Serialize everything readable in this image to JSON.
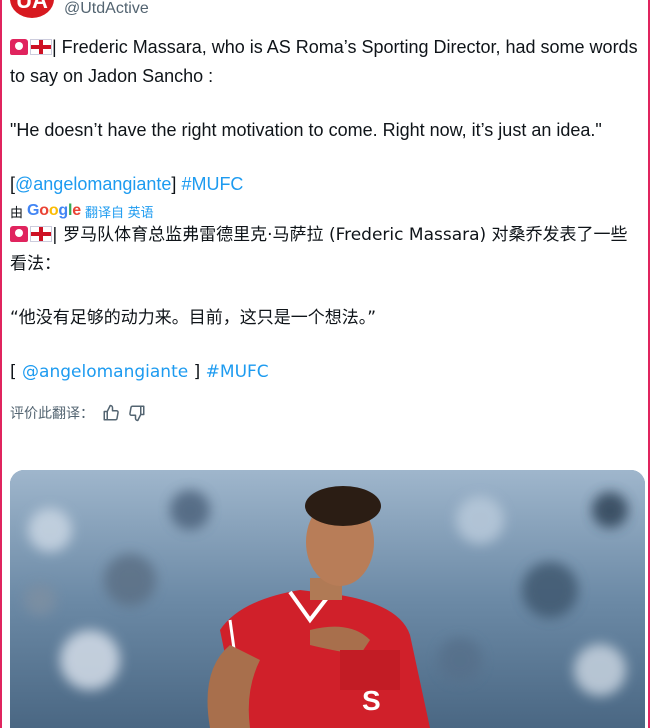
{
  "account": {
    "avatar_text": "UA",
    "handle": "@UtdActive"
  },
  "original": {
    "line1": "| Frederic Massara, who is AS Roma’s Sporting Director, had some words to say on Jadon Sancho :",
    "quote": "\"He doesn’t have the right motivation to come. Right now, it’s just an idea.\"",
    "bracket_open": "[",
    "mention": "@angelomangiante",
    "bracket_close": "]",
    "hashtag": "#MUFC"
  },
  "translation_bar": {
    "prefix": "由",
    "google_letters": [
      "G",
      "o",
      "o",
      "g",
      "l",
      "e"
    ],
    "link": "翻译自 英语"
  },
  "translated": {
    "line1": "| 罗马队体育总监弗雷德里克·马萨拉 (Frederic Massara) 对桑乔发表了一些看法：",
    "quote": "“他没有足够的动力来。目前，这只是一个想法。”",
    "bracket_open": "[",
    "mention": "@angelomangiante",
    "bracket_close": "]",
    "hashtag": "#MUFC"
  },
  "rating": {
    "label": "评价此翻译："
  },
  "icons": [
    "siren-emoji-icon",
    "england-flag-icon",
    "thumbs-up-icon",
    "thumbs-down-icon",
    "google-logo"
  ],
  "colors": {
    "link": "#1d9bf0",
    "secondary_text": "#536471",
    "brand_red": "#d71920",
    "frame_red": "#e0245e"
  },
  "media": {
    "description_hidden": ""
  }
}
